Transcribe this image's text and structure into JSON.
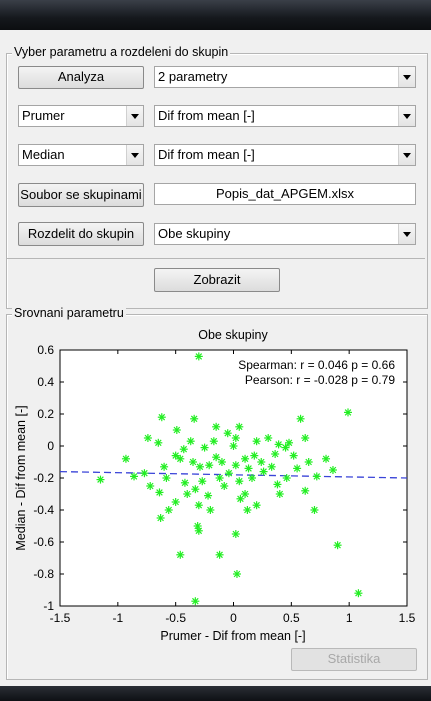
{
  "panel_top": {
    "title": "Vyber parametru a rozdeleni do skupin",
    "analyza_button": "Analyza",
    "analysis_mode": "2 parametry",
    "param1_stat": "Prumer",
    "param1_type": "Dif from mean [-]",
    "param2_stat": "Median",
    "param2_type": "Dif from mean [-]",
    "group_file_button": "Soubor se skupinami",
    "group_file": "Popis_dat_APGEM.xlsx",
    "split_button": "Rozdelit do skupin",
    "group_select": "Obe skupiny",
    "show_button": "Zobrazit"
  },
  "panel_bottom": {
    "title": "Srovnani parametru",
    "statistics_button": "Statistika"
  },
  "colors": {
    "marker": "#22ee22",
    "trend": "#3a44d8"
  },
  "chart_data": {
    "type": "scatter",
    "title": "Obe skupiny",
    "xlabel": "Prumer - Dif from mean [-]",
    "ylabel": "Median - Dif from mean [-]",
    "xlim": [
      -1.5,
      1.5
    ],
    "ylim": [
      -1,
      0.6
    ],
    "xticks": [
      "-1.5",
      "-1",
      "-0.5",
      "0",
      "0.5",
      "1",
      "1.5"
    ],
    "yticks": [
      "0.6",
      "0.4",
      "0.2",
      "0",
      "-0.2",
      "-0.4",
      "-0.6",
      "-0.8",
      "-1"
    ],
    "annotations": [
      "Spearman: r = 0.046 p = 0.66",
      "Pearson: r = -0.028 p = 0.79"
    ],
    "trend_line": {
      "x": [
        -1.5,
        1.5
      ],
      "y": [
        -0.16,
        -0.2
      ]
    },
    "points": [
      [
        -0.3,
        0.56
      ],
      [
        -0.62,
        0.18
      ],
      [
        -0.34,
        0.17
      ],
      [
        -0.49,
        0.1
      ],
      [
        -0.15,
        0.12
      ],
      [
        -0.74,
        0.05
      ],
      [
        -0.65,
        0.02
      ],
      [
        0.05,
        0.12
      ],
      [
        0.58,
        0.17
      ],
      [
        0.99,
        0.21
      ],
      [
        -0.05,
        0.08
      ],
      [
        -0.17,
        0.03
      ],
      [
        0.02,
        0.05
      ],
      [
        0.2,
        0.03
      ],
      [
        0.48,
        0.02
      ],
      [
        0.39,
        0.01
      ],
      [
        0.45,
        -0.01
      ],
      [
        0.62,
        0.05
      ],
      [
        -0.43,
        -0.02
      ],
      [
        -0.25,
        -0.01
      ],
      [
        -0.37,
        0.03
      ],
      [
        -0.93,
        -0.08
      ],
      [
        -0.77,
        -0.17
      ],
      [
        -0.6,
        -0.13
      ],
      [
        -0.5,
        -0.06
      ],
      [
        -0.46,
        -0.08
      ],
      [
        -0.35,
        -0.1
      ],
      [
        -0.29,
        -0.13
      ],
      [
        -0.21,
        -0.12
      ],
      [
        -0.15,
        -0.07
      ],
      [
        -0.1,
        -0.1
      ],
      [
        0.02,
        -0.12
      ],
      [
        0.1,
        -0.08
      ],
      [
        0.18,
        -0.06
      ],
      [
        0.24,
        -0.1
      ],
      [
        0.33,
        -0.13
      ],
      [
        0.36,
        -0.05
      ],
      [
        0.52,
        -0.06
      ],
      [
        0.65,
        -0.1
      ],
      [
        0.8,
        -0.08
      ],
      [
        0.86,
        -0.15
      ],
      [
        -1.15,
        -0.21
      ],
      [
        -0.86,
        -0.19
      ],
      [
        -0.72,
        -0.25
      ],
      [
        -0.58,
        -0.2
      ],
      [
        -0.42,
        -0.23
      ],
      [
        -0.4,
        -0.3
      ],
      [
        -0.33,
        -0.27
      ],
      [
        -0.27,
        -0.22
      ],
      [
        -0.22,
        -0.31
      ],
      [
        -0.12,
        -0.2
      ],
      [
        -0.08,
        -0.25
      ],
      [
        0.05,
        -0.22
      ],
      [
        0.1,
        -0.3
      ],
      [
        0.16,
        -0.2
      ],
      [
        0.26,
        -0.16
      ],
      [
        0.38,
        -0.24
      ],
      [
        0.46,
        -0.2
      ],
      [
        0.55,
        -0.14
      ],
      [
        0.72,
        -0.19
      ],
      [
        -0.64,
        -0.29
      ],
      [
        -0.5,
        -0.35
      ],
      [
        -0.3,
        -0.37
      ],
      [
        -0.2,
        -0.4
      ],
      [
        0.06,
        -0.33
      ],
      [
        0.12,
        -0.4
      ],
      [
        0.2,
        -0.37
      ],
      [
        0.4,
        -0.3
      ],
      [
        0.7,
        -0.4
      ],
      [
        -0.63,
        -0.45
      ],
      [
        -0.31,
        -0.5
      ],
      [
        -0.3,
        -0.53
      ],
      [
        0.02,
        -0.55
      ],
      [
        -0.46,
        -0.68
      ],
      [
        -0.12,
        -0.68
      ],
      [
        0.03,
        -0.8
      ],
      [
        0.9,
        -0.62
      ],
      [
        1.08,
        -0.92
      ],
      [
        -0.33,
        -0.97
      ],
      [
        0.0,
        0.0
      ],
      [
        0.13,
        -0.14
      ],
      [
        -0.04,
        -0.17
      ],
      [
        0.3,
        0.05
      ],
      [
        -0.56,
        -0.4
      ],
      [
        0.62,
        -0.28
      ]
    ]
  }
}
